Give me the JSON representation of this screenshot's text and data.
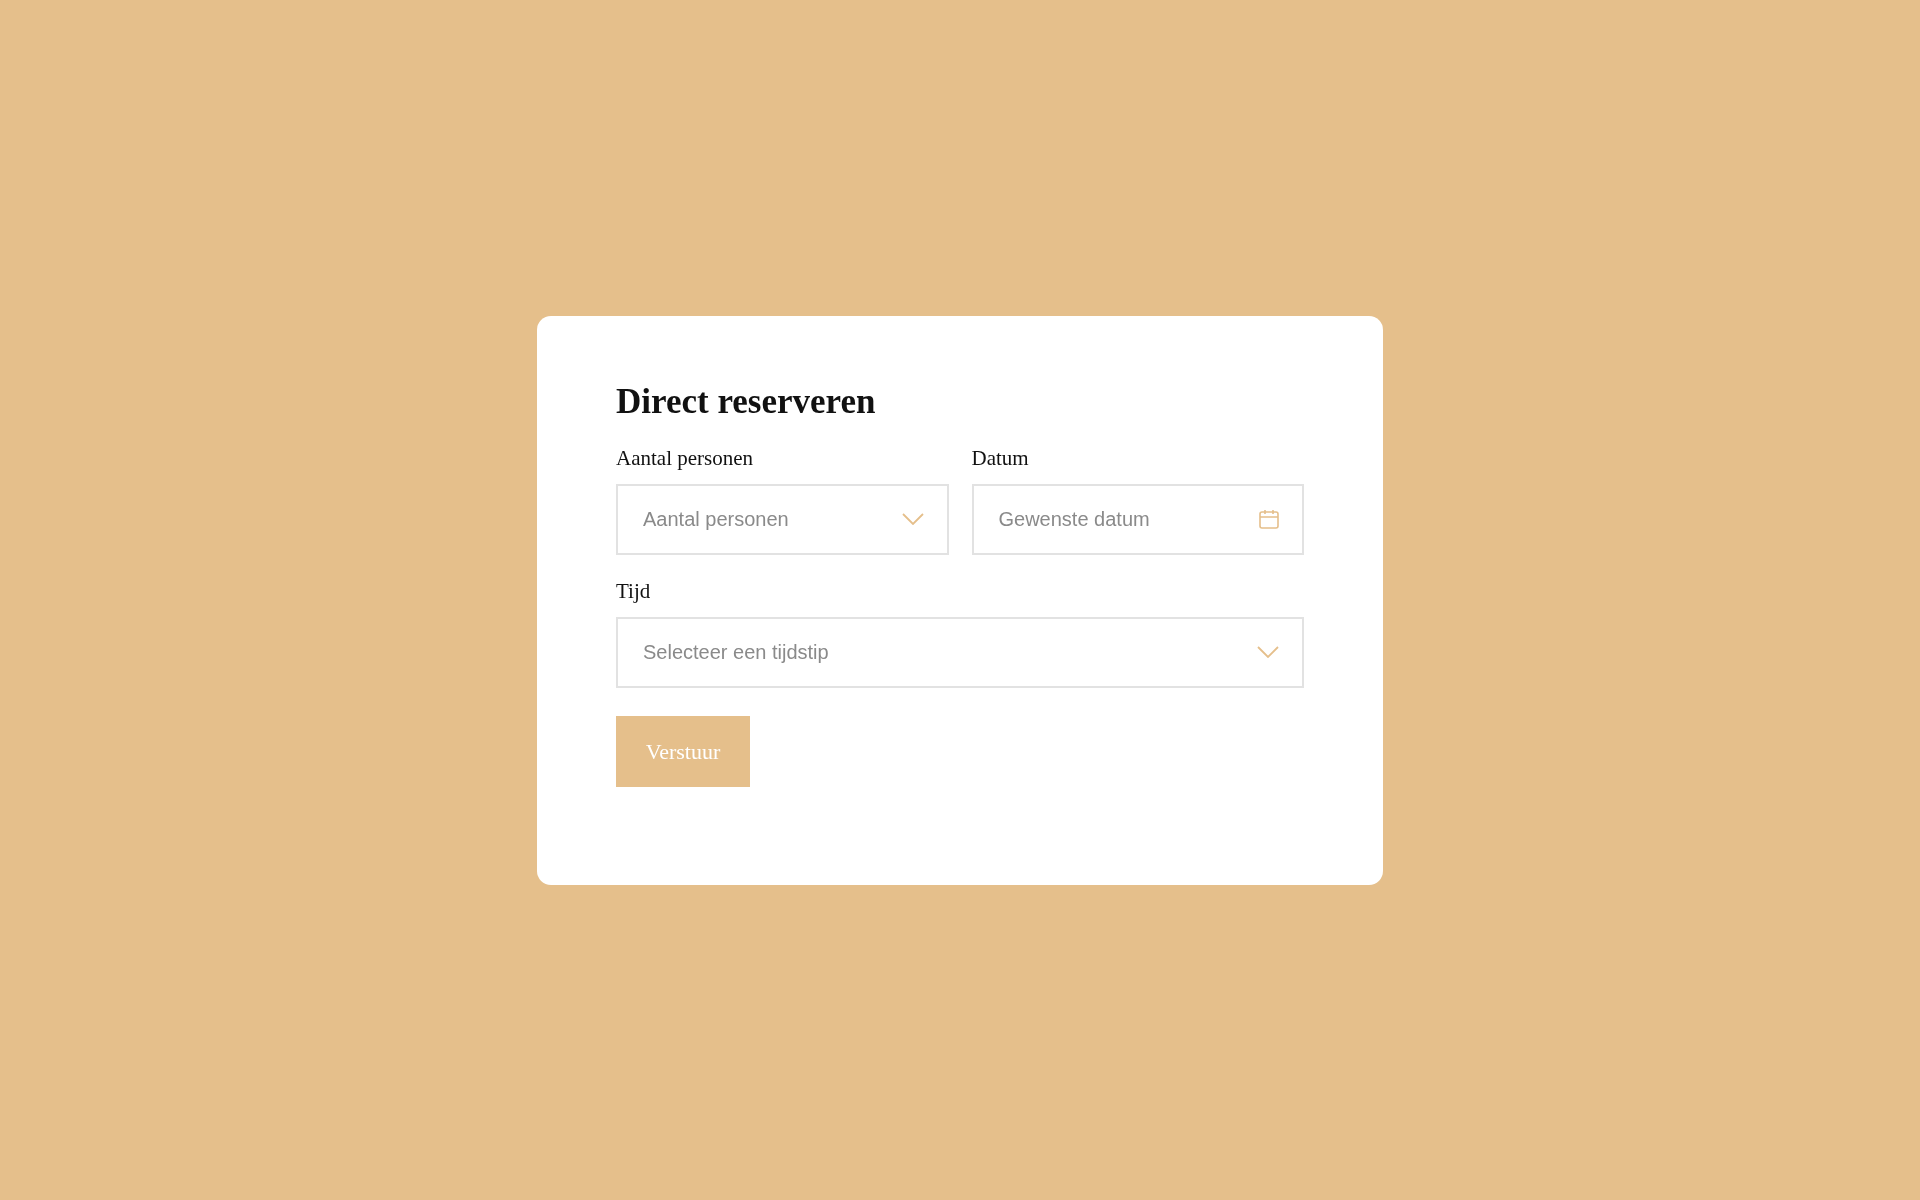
{
  "form": {
    "title": "Direct reserveren",
    "rows": [
      [
        {
          "label": "Aantal personen",
          "kind": "select",
          "placeholder": "Aantal personen"
        },
        {
          "label": "Datum",
          "kind": "date",
          "placeholder": "Gewenste datum"
        }
      ],
      [
        {
          "label": "Tijd",
          "kind": "select",
          "placeholder": "Selecteer een tijdstip"
        }
      ]
    ],
    "submit": "Verstuur"
  }
}
